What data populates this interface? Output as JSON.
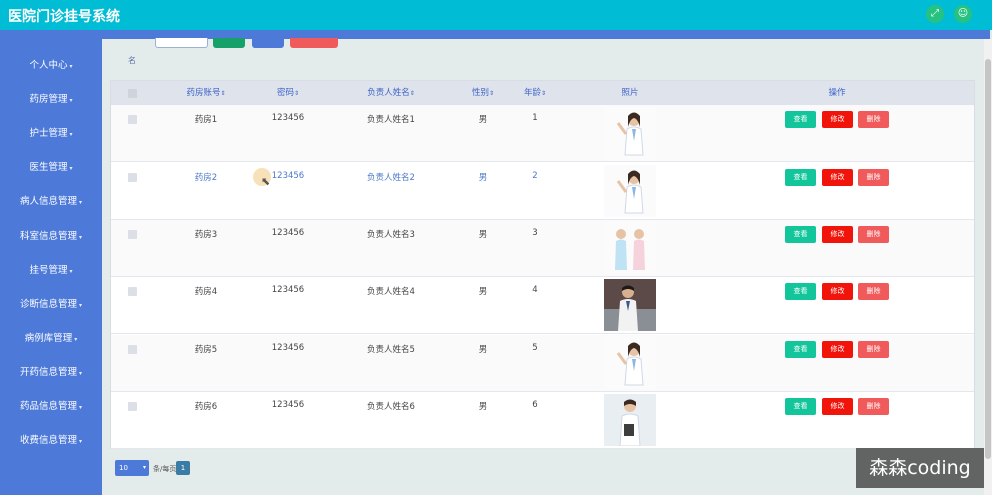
{
  "app_title": "医院门诊挂号系统",
  "top_icons": {
    "fullscreen": "fullscreen-icon",
    "user": "user-icon"
  },
  "sidebar": {
    "items": [
      {
        "label": "个人中心"
      },
      {
        "label": "药房管理"
      },
      {
        "label": "护士管理"
      },
      {
        "label": "医生管理"
      },
      {
        "label": "病人信息管理"
      },
      {
        "label": "科室信息管理"
      },
      {
        "label": "挂号管理"
      },
      {
        "label": "诊断信息管理"
      },
      {
        "label": "病例库管理"
      },
      {
        "label": "开药信息管理"
      },
      {
        "label": "药品信息管理"
      },
      {
        "label": "收费信息管理"
      }
    ]
  },
  "search": {
    "field_label_fragment": "名"
  },
  "table": {
    "headers": {
      "account": "药房账号",
      "password": "密码",
      "manager": "负责人姓名",
      "gender": "性别",
      "age": "年龄",
      "photo": "照片",
      "action": "操作"
    },
    "sort_glyph": "⇕",
    "actions": {
      "view": "查看",
      "edit": "修改",
      "delete": "删除"
    },
    "rows": [
      {
        "account": "药房1",
        "password": "123456",
        "manager": "负责人姓名1",
        "gender": "男",
        "age": "1"
      },
      {
        "account": "药房2",
        "password": "123456",
        "manager": "负责人姓名2",
        "gender": "男",
        "age": "2"
      },
      {
        "account": "药房3",
        "password": "123456",
        "manager": "负责人姓名3",
        "gender": "男",
        "age": "3"
      },
      {
        "account": "药房4",
        "password": "123456",
        "manager": "负责人姓名4",
        "gender": "男",
        "age": "4"
      },
      {
        "account": "药房5",
        "password": "123456",
        "manager": "负责人姓名5",
        "gender": "男",
        "age": "5"
      },
      {
        "account": "药房6",
        "password": "123456",
        "manager": "负责人姓名6",
        "gender": "男",
        "age": "6"
      }
    ]
  },
  "pagination": {
    "page_size": "10",
    "per_page_label": "条/每页",
    "current_page": "1"
  },
  "watermark": "森森coding",
  "colors": {
    "topbar": "#00bcd4",
    "sidebar": "#4d7ad9",
    "view_button": "#13c59a",
    "edit_button": "#f0140a",
    "delete_button": "#f05a5a"
  }
}
